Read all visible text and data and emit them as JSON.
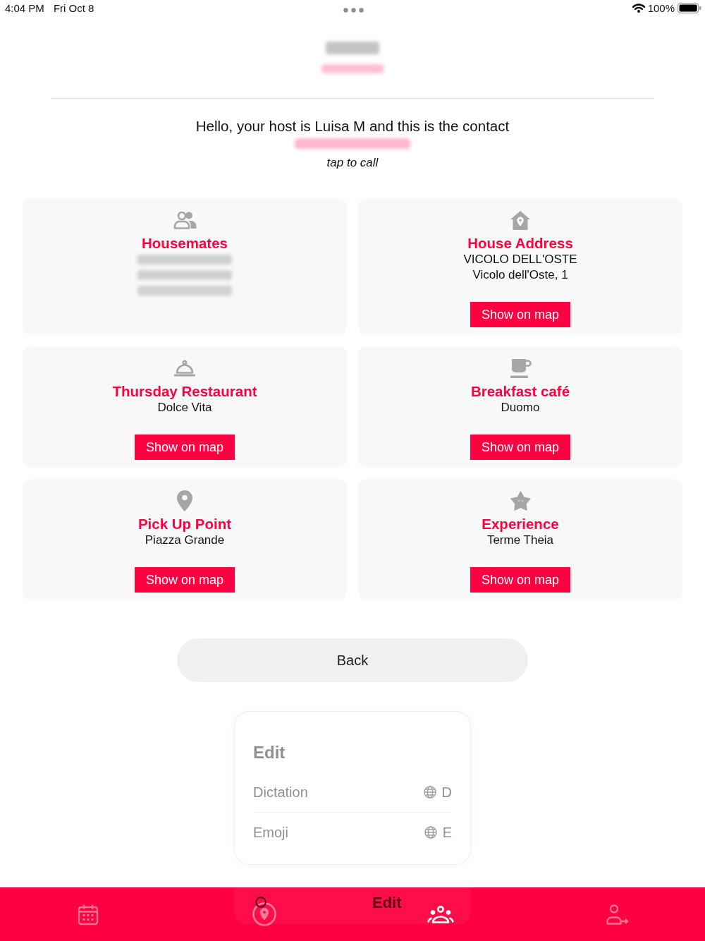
{
  "status_bar": {
    "time": "4:04 PM",
    "date": "Fri Oct 8",
    "battery": "100%"
  },
  "header": {
    "name_redacted": true,
    "subtitle_redacted": true
  },
  "contact": {
    "greeting": "Hello, your host is Luisa M and this is the contact",
    "phone_redacted": true,
    "hint": "tap to call"
  },
  "cards": [
    {
      "kind": "people",
      "title": "Housemates",
      "lines": [
        {
          "redacted": true
        },
        {
          "redacted": true
        },
        {
          "redacted": true
        }
      ]
    },
    {
      "kind": "house",
      "title": "House Address",
      "lines": [
        {
          "text": "VICOLO DELL'OSTE"
        },
        {
          "text": "Vicolo dell'Oste, 1"
        }
      ],
      "button": "Show on map"
    },
    {
      "kind": "restaurant",
      "title": "Thursday Restaurant",
      "lines": [
        {
          "text": "Dolce Vita"
        }
      ],
      "button": "Show on map"
    },
    {
      "kind": "cafe",
      "title": "Breakfast café",
      "lines": [
        {
          "text": "Duomo"
        }
      ],
      "button": "Show on map"
    },
    {
      "kind": "pin",
      "title": "Pick Up Point",
      "lines": [
        {
          "text": "Piazza Grande"
        }
      ],
      "button": "Show on map"
    },
    {
      "kind": "star",
      "title": "Experience",
      "lines": [
        {
          "text": "Terme Theia"
        }
      ],
      "button": "Show on map"
    }
  ],
  "back_button": "Back",
  "edit_menu": {
    "title": "Edit",
    "items": [
      {
        "label": "Dictation",
        "shortcut": "D"
      },
      {
        "label": "Emoji",
        "shortcut": "E"
      }
    ],
    "footer": "Edit"
  },
  "tab_bar": [
    {
      "kind": "calendar",
      "selected": false
    },
    {
      "kind": "location",
      "selected": false
    },
    {
      "kind": "group",
      "selected": true
    },
    {
      "kind": "profile",
      "selected": false
    }
  ]
}
